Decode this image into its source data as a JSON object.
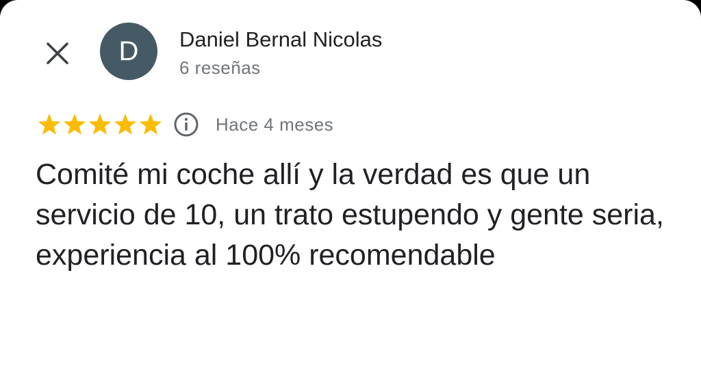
{
  "close_button": {
    "icon": "close-icon"
  },
  "author": {
    "avatar_letter": "D",
    "avatar_color": "#455a64",
    "name": "Daniel Bernal Nicolas",
    "meta": "6 reseñas"
  },
  "review": {
    "rating": 5,
    "rating_max": 5,
    "star_color": "#fbbc04",
    "info_icon": "info-icon",
    "time": "Hace 4 meses",
    "text": "Comité mi coche allí y la verdad es que un servicio de 10, un trato estupendo y gente seria, experiencia al 100% recomendable"
  }
}
